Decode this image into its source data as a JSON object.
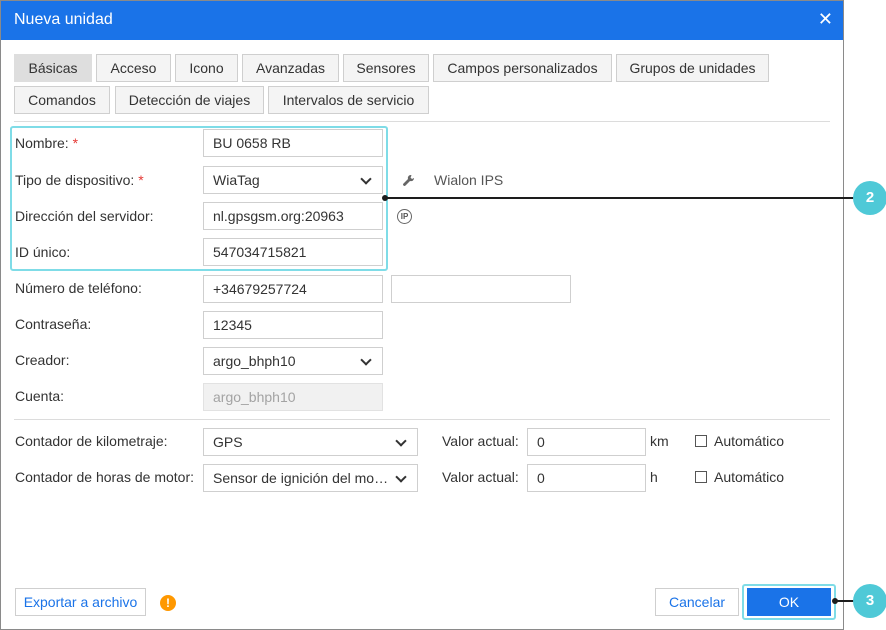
{
  "dialog": {
    "title": "Nueva unidad",
    "close_glyph": "✕"
  },
  "tabs": [
    {
      "label": "Básicas",
      "active": true
    },
    {
      "label": "Acceso"
    },
    {
      "label": "Icono"
    },
    {
      "label": "Avanzadas"
    },
    {
      "label": "Sensores"
    },
    {
      "label": "Campos personalizados"
    },
    {
      "label": "Grupos de unidades"
    },
    {
      "label": "Comandos"
    },
    {
      "label": "Detección de viajes"
    },
    {
      "label": "Intervalos de servicio"
    }
  ],
  "form": {
    "name": {
      "label": "Nombre:",
      "required": "*",
      "value": "BU 0658 RB"
    },
    "device_type": {
      "label": "Tipo de dispositivo:",
      "required": "*",
      "value": "WiaTag",
      "protocol_icon": "wrench-icon",
      "protocol": "Wialon IPS"
    },
    "server_address": {
      "label": "Dirección del servidor:",
      "value": "nl.gpsgsm.org:20963",
      "info_icon": "ip-icon",
      "info_text": "IP"
    },
    "unique_id": {
      "label": "ID único:",
      "value": "547034715821"
    },
    "phone": {
      "label": "Número de teléfono:",
      "value": "+34679257724",
      "value2": ""
    },
    "password": {
      "label": "Contraseña:",
      "value": "12345"
    },
    "creator": {
      "label": "Creador:",
      "value": "argo_bhph10"
    },
    "account": {
      "label": "Cuenta:",
      "value": "argo_bhph10"
    },
    "mileage": {
      "label": "Contador de kilometraje:",
      "value": "GPS",
      "current_label": "Valor actual:",
      "current_value": "0",
      "unit": "km",
      "auto_label": "Automático"
    },
    "engine_hours": {
      "label": "Contador de horas de motor:",
      "value": "Sensor de ignición del motor",
      "current_label": "Valor actual:",
      "current_value": "0",
      "unit": "h",
      "auto_label": "Automático"
    }
  },
  "footer": {
    "export_label": "Exportar a archivo",
    "warning_glyph": "!",
    "cancel_label": "Cancelar",
    "ok_label": "OK"
  },
  "callouts": {
    "two": "2",
    "three": "3"
  },
  "colors": {
    "accent": "#1a73e8",
    "highlight": "#7fdce7",
    "badge": "#4fc9d7",
    "required": "#e53935",
    "warning": "#ff9800"
  }
}
